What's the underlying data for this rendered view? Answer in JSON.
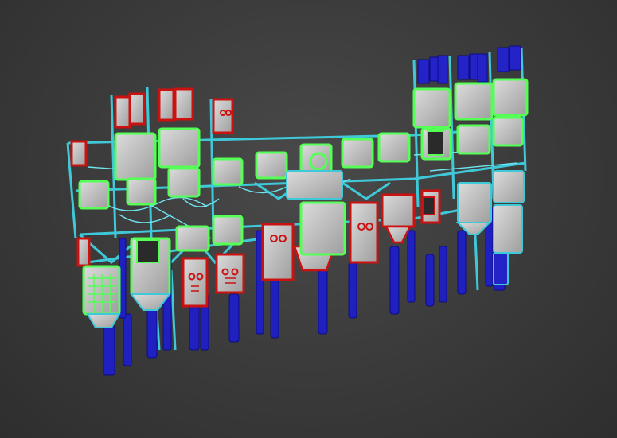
{
  "viewport": {
    "background": "#3a3a3a",
    "description_free": true
  },
  "palette": {
    "green_outline": "#55ff55",
    "red_outline": "#cc1111",
    "cyan_structure": "#3fc8d8",
    "blue_pipe": "#1a1ac8",
    "box_fill": "#c9c9c9",
    "box_fill_dark": "#a9a9a9"
  }
}
